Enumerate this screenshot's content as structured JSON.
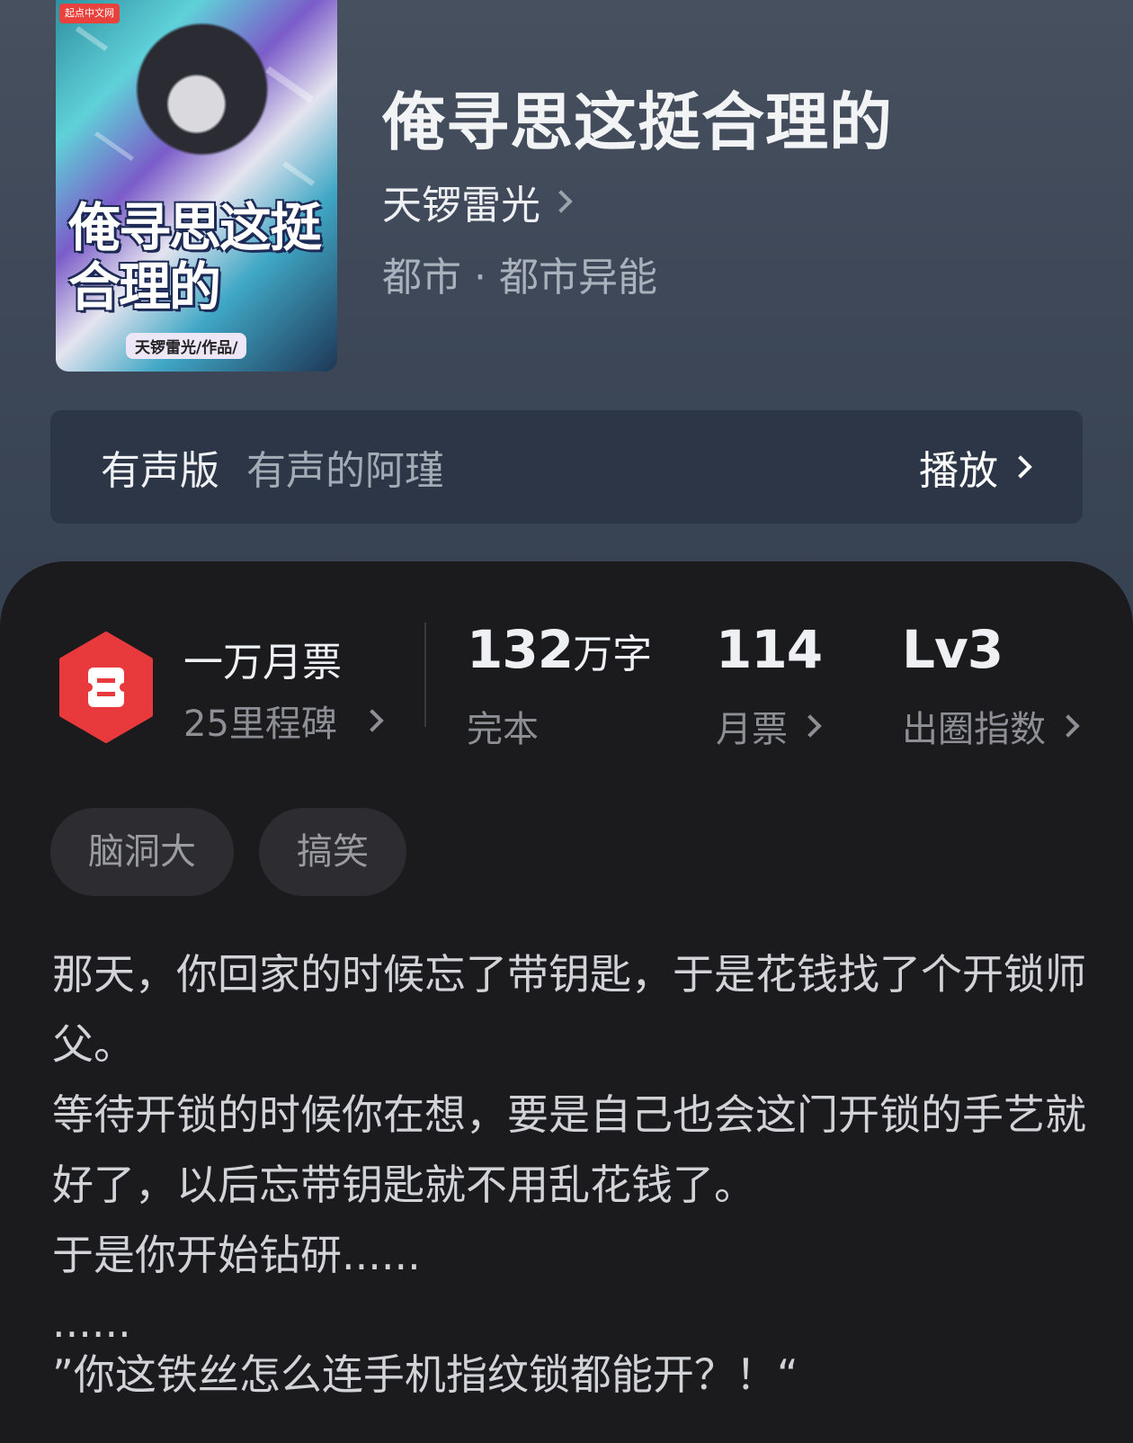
{
  "book": {
    "cover": {
      "publisher_tag": "起点中文网",
      "title_art": "俺寻思这挺合理的",
      "author_art": "天锣雷光/作品/"
    },
    "title": "俺寻思这挺合理的",
    "author": "天锣雷光",
    "genre": "都市 · 都市异能"
  },
  "audio": {
    "label": "有声版",
    "narrator": "有声的阿瑾",
    "action": "播放"
  },
  "stats": {
    "badge_icon": "ticket-hexagon-icon",
    "badge_color": "#e8393c",
    "milestone_title": "一万月票",
    "milestone_sub": "25里程碑",
    "words_value": "132",
    "words_unit": "万字",
    "words_status": "完本",
    "monthly_votes_value": "114",
    "monthly_votes_label": "月票",
    "popularity_value": "Lv3",
    "popularity_label": "出圈指数"
  },
  "tags": [
    "脑洞大",
    "搞笑"
  ],
  "synopsis": [
    "那天，你回家的时候忘了带钥匙，于是花钱找了个开锁师父。",
    "等待开锁的时候你在想，要是自己也会这门开锁的手艺就好了，以后忘带钥匙就不用乱花钱了。",
    "于是你开始钻研......",
    "......",
    "”你这铁丝怎么连手机指纹锁都能开？！“"
  ]
}
